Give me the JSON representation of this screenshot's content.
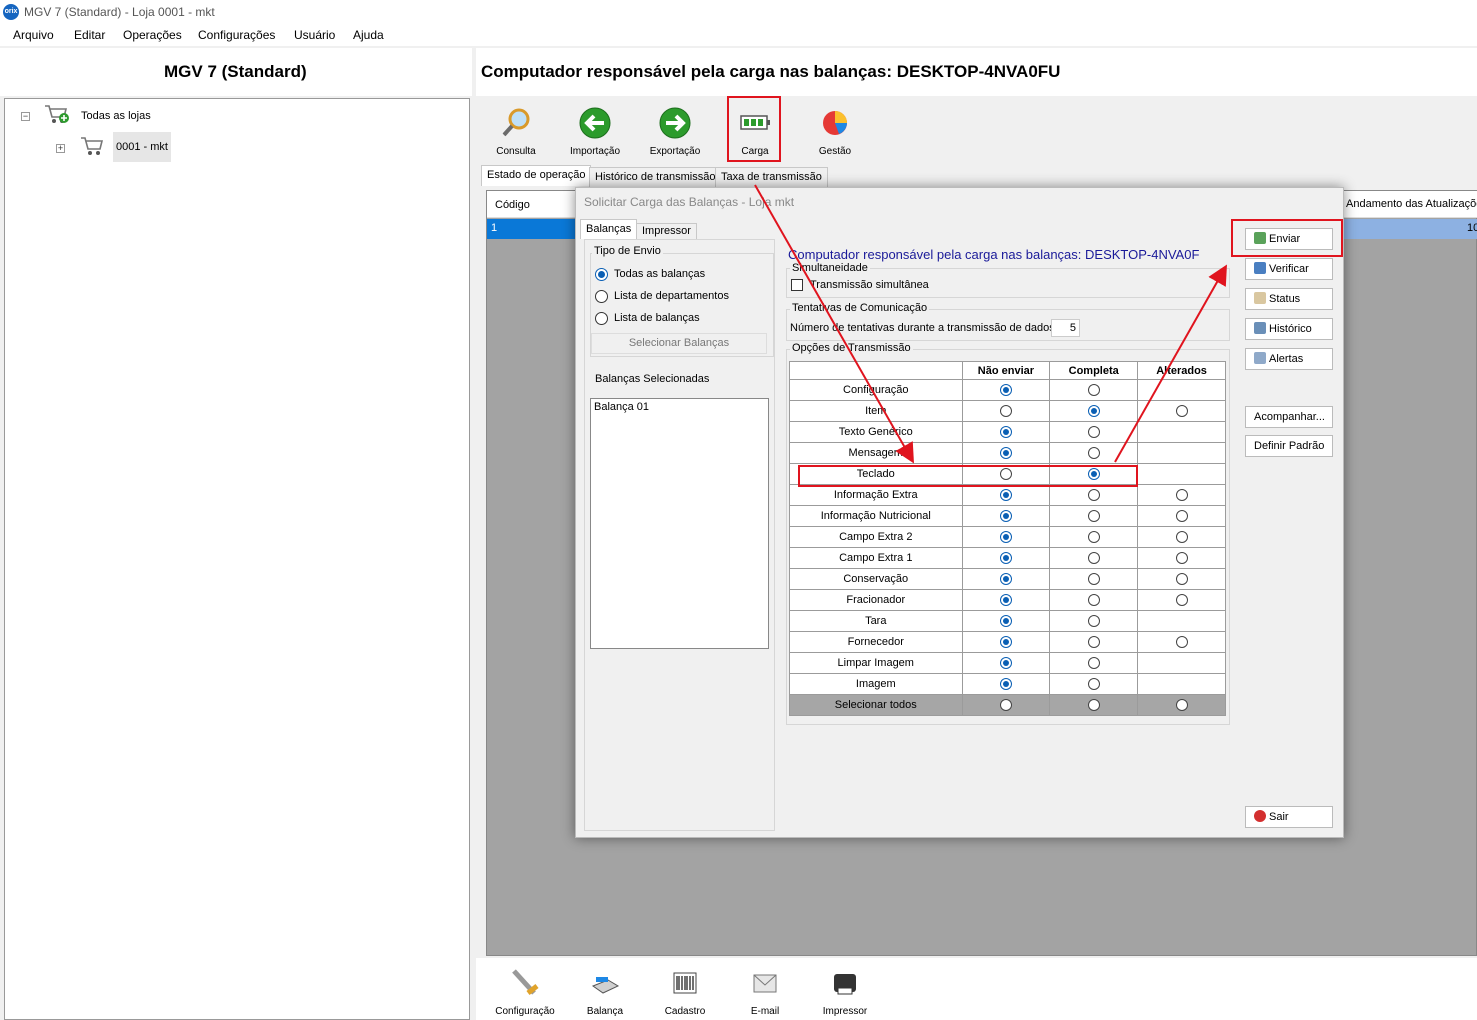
{
  "window": {
    "title": "MGV 7 (Standard) - Loja 0001 - mkt",
    "logo": "orix"
  },
  "menu": [
    "Arquivo",
    "Editar",
    "Operações",
    "Configurações",
    "Usuário",
    "Ajuda"
  ],
  "header": {
    "left_title": "MGV 7 (Standard)",
    "right_title": "Computador responsável pela carga nas balanças: DESKTOP-4NVA0FU"
  },
  "tree": {
    "root": "Todas as lojas",
    "child": "0001 - mkt"
  },
  "toolbar": [
    "Consulta",
    "Importação",
    "Exportação",
    "Carga",
    "Gestão"
  ],
  "tabs": [
    "Estado de operação",
    "Histórico de transmissão",
    "Taxa de transmissão"
  ],
  "grid": {
    "col_codigo": "Código",
    "col_andamento": "Andamento das Atualizações",
    "row_codigo": "1",
    "row_value": "10"
  },
  "bottom_toolbar": [
    "Configuração",
    "Balança",
    "Cadastro",
    "E-mail",
    "Impressor"
  ],
  "dialog": {
    "title": "Solicitar Carga das Balanças - Loja mkt",
    "tabs": [
      "Balanças",
      "Impressor"
    ],
    "tipo_envio": {
      "title": "Tipo de Envio",
      "options": [
        "Todas as balanças",
        "Lista de departamentos",
        "Lista de balanças"
      ],
      "selected": 0,
      "select_button": "Selecionar Balanças"
    },
    "selected_label": "Balanças Selecionadas",
    "selected_list": [
      "Balança 01"
    ],
    "computer_label": "Computador responsável pela carga nas balanças: DESKTOP-4NVA0F",
    "simultaneidade": {
      "title": "Simultaneidade",
      "checkbox": "Transmissão simultânea"
    },
    "tentativas": {
      "title": "Tentativas de Comunicação",
      "label": "Número de tentativas durante a transmissão de dados",
      "value": "5"
    },
    "opcoes": {
      "title": "Opções de Transmissão",
      "headers": [
        "Não enviar",
        "Completa",
        "Alterados"
      ],
      "rows": [
        {
          "name": "Configuração",
          "sel": 0,
          "cols": 2
        },
        {
          "name": "Item",
          "sel": 1,
          "cols": 3
        },
        {
          "name": "Texto Genérico",
          "sel": 0,
          "cols": 2
        },
        {
          "name": "Mensagem",
          "sel": 0,
          "cols": 2
        },
        {
          "name": "Teclado",
          "sel": 1,
          "cols": 2
        },
        {
          "name": "Informação Extra",
          "sel": 0,
          "cols": 3
        },
        {
          "name": "Informação Nutricional",
          "sel": 0,
          "cols": 3
        },
        {
          "name": "Campo Extra 2",
          "sel": 0,
          "cols": 3
        },
        {
          "name": "Campo Extra 1",
          "sel": 0,
          "cols": 3
        },
        {
          "name": "Conservação",
          "sel": 0,
          "cols": 3
        },
        {
          "name": "Fracionador",
          "sel": 0,
          "cols": 3
        },
        {
          "name": "Tara",
          "sel": 0,
          "cols": 2
        },
        {
          "name": "Fornecedor",
          "sel": 0,
          "cols": 3
        },
        {
          "name": "Limpar Imagem",
          "sel": 0,
          "cols": 2
        },
        {
          "name": "Imagem",
          "sel": 0,
          "cols": 2
        }
      ],
      "select_all": "Selecionar todos"
    },
    "buttons": [
      "Enviar",
      "Verificar",
      "Status",
      "Histórico",
      "Alertas",
      "Acompanhar...",
      "Definir Padrão"
    ],
    "exit_button": "Sair"
  },
  "colors": {
    "highlight_red": "#e0141e",
    "selection_blue": "#0a78d7",
    "radio_blue": "#0a5fb4"
  }
}
